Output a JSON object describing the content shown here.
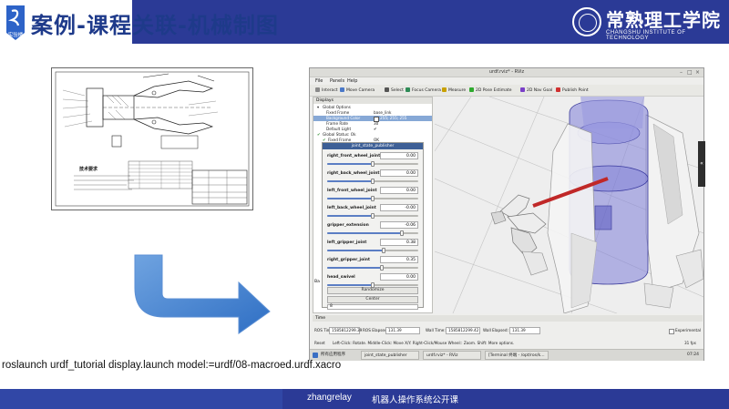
{
  "header": {
    "logo_text": "实验楼",
    "title": "案例-课程关联-机械制图",
    "university_name": "常熟理工学院",
    "university_name_en": "CHANGSHU INSTITUTE OF TECHNOLOGY"
  },
  "drawing": {
    "tech_req_title": "技术要求"
  },
  "rviz": {
    "window_title": "urdf.rviz* - RViz",
    "menu": [
      "File",
      "Panels",
      "Help"
    ],
    "toolbar": [
      {
        "label": "Interact",
        "icon": "interact-icon",
        "color": "#8a8a8a"
      },
      {
        "label": "Move Camera",
        "icon": "move-camera-icon",
        "color": "#4a78c8"
      },
      {
        "label": "Select",
        "icon": "select-icon",
        "color": "#555555"
      },
      {
        "label": "Focus Camera",
        "icon": "focus-camera-icon",
        "color": "#2e8b57"
      },
      {
        "label": "Measure",
        "icon": "measure-icon",
        "color": "#c8a000"
      },
      {
        "label": "2D Pose Estimate",
        "icon": "pose-estimate-icon",
        "color": "#2eaa2e"
      },
      {
        "label": "2D Nav Goal",
        "icon": "nav-goal-icon",
        "color": "#7a3fc8"
      },
      {
        "label": "Publish Point",
        "icon": "publish-point-icon",
        "color": "#d03030"
      }
    ],
    "displays": {
      "title": "Displays",
      "rows": [
        {
          "key": "Global Options",
          "value": ""
        },
        {
          "key": "Fixed Frame",
          "value": "base_link"
        },
        {
          "key": "Background Color",
          "value": "255; 255; 255"
        },
        {
          "key": "Frame Rate",
          "value": "30"
        },
        {
          "key": "Default Light",
          "value": "✔"
        },
        {
          "key": "Global Status: Ok",
          "value": ""
        },
        {
          "key": "Fixed Frame",
          "value": "OK"
        }
      ]
    },
    "joint_state_publisher": {
      "title": "joint_state_publisher",
      "joints": [
        {
          "name": "right_front_wheel_joint",
          "value": "0.00",
          "level": 0.5
        },
        {
          "name": "right_back_wheel_joint",
          "value": "0.00",
          "level": 0.5
        },
        {
          "name": "left_front_wheel_joint",
          "value": "0.00",
          "level": 0.5
        },
        {
          "name": "left_back_wheel_joint",
          "value": "-0.00",
          "level": 0.5
        },
        {
          "name": "gripper_extension",
          "value": "-0.06",
          "level": 0.82
        },
        {
          "name": "left_gripper_joint",
          "value": "0.38",
          "level": 0.62
        },
        {
          "name": "right_gripper_joint",
          "value": "0.35",
          "level": 0.6
        },
        {
          "name": "head_swivel",
          "value": "0.00",
          "level": 0.5
        }
      ],
      "randomize_label": "Randomize",
      "center_label": "Center",
      "spin_value": "8"
    },
    "side_tab": "Ba",
    "time": {
      "panel_title": "Time",
      "ros_time_label": "ROS Time:",
      "ros_time": "1585812299.39",
      "ros_elapsed_label": "ROS Elapsed:",
      "ros_elapsed": "131.39",
      "wall_time_label": "Wall Time:",
      "wall_time": "1585812299.42",
      "wall_elapsed_label": "Wall Elapsed:",
      "wall_elapsed": "131.39",
      "experimental_label": "Experimental"
    },
    "status": {
      "reset_label": "Reset",
      "hint": "Left-Click: Rotate. Middle-Click: Move X/Y. Right-Click/Mouse Wheel:: Zoom. Shift: More options.",
      "fps": "31 fps"
    },
    "taskbar": {
      "apps": "所有应用程序",
      "items": [
        "joint_state_publisher",
        "urdf.rviz* - RViz",
        "[Terminal 终端 - /opt/ros/k…"
      ],
      "clock": "07:24"
    }
  },
  "command": "roslaunch urdf_tutorial display.launch model:=urdf/08-macroed.urdf.xacro",
  "footer": {
    "author": "zhangrelay",
    "course": "机器人操作系统公开课"
  }
}
